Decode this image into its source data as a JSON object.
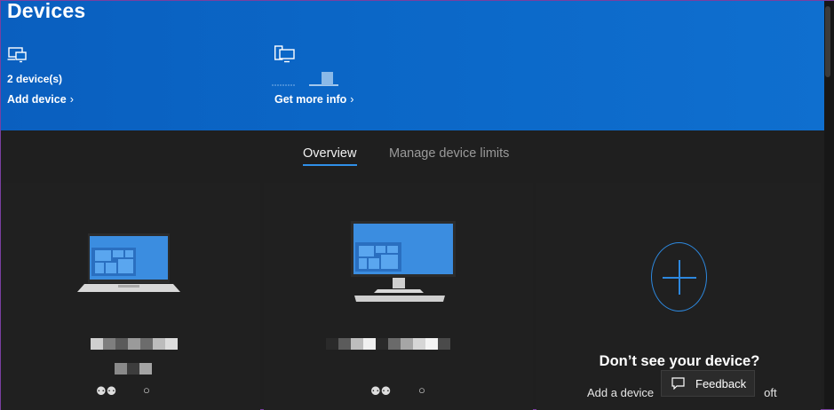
{
  "header": {
    "title": "Devices"
  },
  "summary": {
    "devices": {
      "icon": "devices-icon",
      "count_text": "2 device(s)",
      "link_label": "Add device"
    },
    "info": {
      "icon": "computer-phone-icon",
      "link_label": "Get more info"
    }
  },
  "tabs": [
    {
      "label": "Overview",
      "active": true
    },
    {
      "label": "Manage device limits",
      "active": false
    }
  ],
  "devices": [
    {
      "type": "laptop",
      "icon": "laptop-icon"
    },
    {
      "type": "desktop",
      "icon": "desktop-icon"
    }
  ],
  "add_device_card": {
    "icon": "plus-icon",
    "title": "Don’t see your device?",
    "subtitle_partial": "Add a device",
    "subtitle_tail": "oft"
  },
  "feedback": {
    "label": "Feedback",
    "icon": "feedback-icon"
  },
  "colors": {
    "accent": "#0b67c7",
    "tab_underline": "#2f8fe8",
    "plus": "#2d88de",
    "screen_blue": "#3b8de0"
  }
}
